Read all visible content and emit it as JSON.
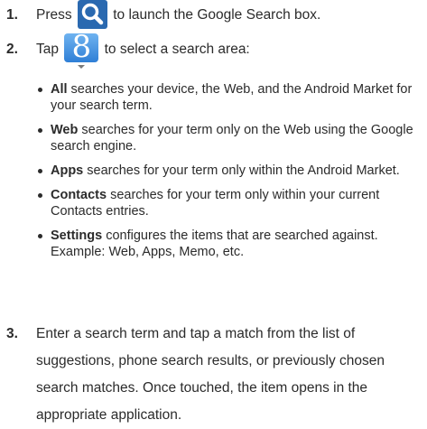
{
  "steps": [
    {
      "number": "1.",
      "before_icon": "Press",
      "icon": "search-key-icon",
      "after_icon": "to launch the Google Search box."
    },
    {
      "number": "2.",
      "before_icon": "Tap",
      "icon": "google-search-icon",
      "icon_letter": "8",
      "after_icon": "to select a search area:"
    },
    {
      "number": "3.",
      "text": "Enter a search term and tap a match from the list of suggestions, phone search results, or previously chosen search matches. Once touched, the item opens in the appropriate application."
    }
  ],
  "bullets": [
    {
      "term": "All",
      "text": " searches your device, the Web, and the Android Market for your search term."
    },
    {
      "term": "Web",
      "text": " searches for your term only on the Web using the Google search engine."
    },
    {
      "term": "Apps",
      "text": " searches for your term only within the Android Market."
    },
    {
      "term": "Contacts",
      "text": " searches for your term only within your current Contacts entries."
    },
    {
      "term": "Settings",
      "text": " configures the items that are searched against. Example: Web, Apps, Memo, etc."
    }
  ],
  "colors": {
    "search_key_bg": "#2a69b0",
    "google_key_bg": "#2f7fd6",
    "text": "#2b2b2b"
  }
}
